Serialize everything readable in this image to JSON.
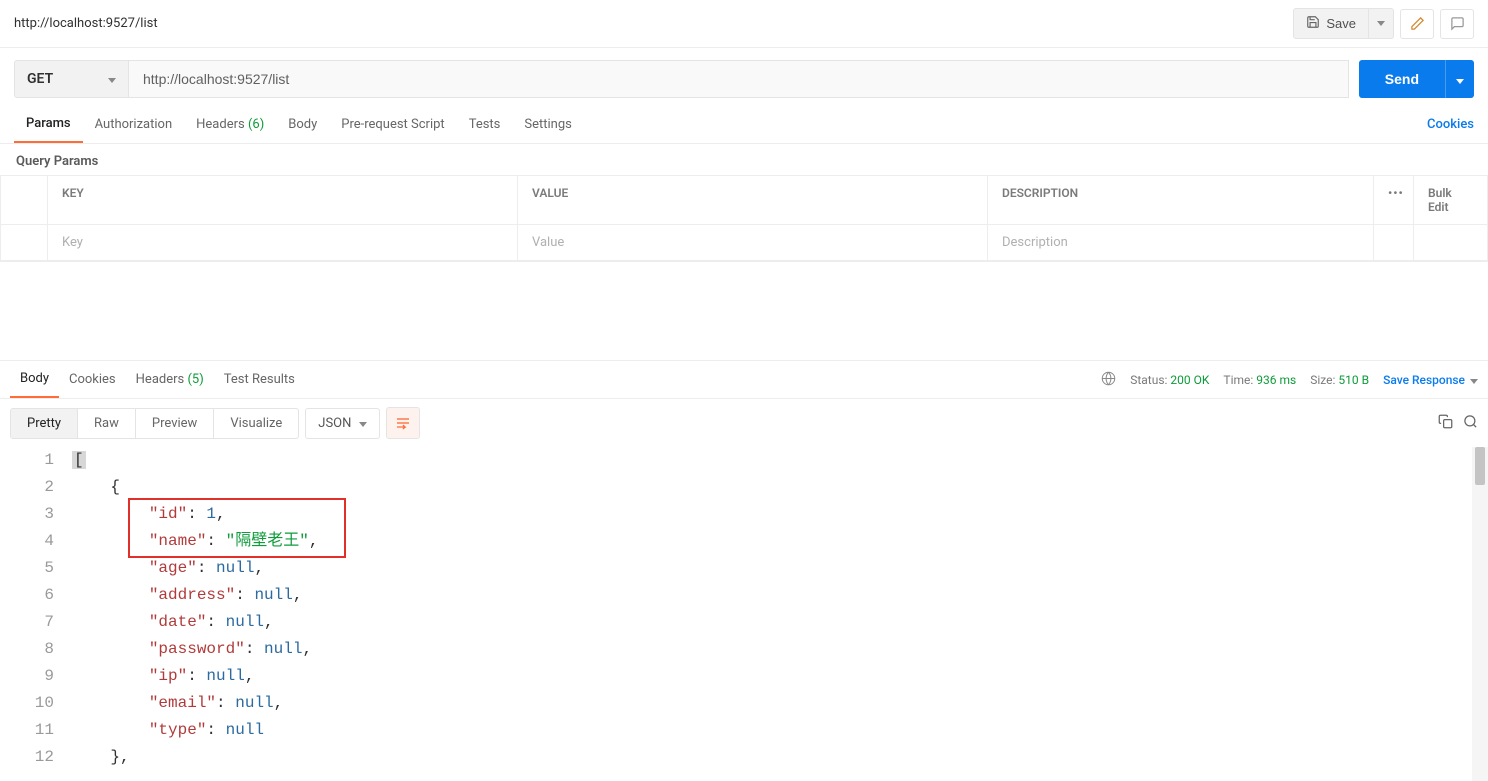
{
  "request": {
    "title": "http://localhost:9527/list",
    "method": "GET",
    "url": "http://localhost:9527/list",
    "saveLabel": "Save",
    "sendLabel": "Send"
  },
  "reqTabs": {
    "params": "Params",
    "authorization": "Authorization",
    "headers": "Headers",
    "headersCount": "(6)",
    "body": "Body",
    "prerequest": "Pre-request Script",
    "tests": "Tests",
    "settings": "Settings",
    "cookies": "Cookies"
  },
  "queryParams": {
    "sectionLabel": "Query Params",
    "colKey": "KEY",
    "colValue": "VALUE",
    "colDesc": "DESCRIPTION",
    "bulkEdit": "Bulk Edit",
    "more": "•••",
    "phKey": "Key",
    "phValue": "Value",
    "phDesc": "Description"
  },
  "respTabs": {
    "body": "Body",
    "cookies": "Cookies",
    "headers": "Headers",
    "headersCount": "(5)",
    "testResults": "Test Results"
  },
  "respMeta": {
    "statusLabel": "Status:",
    "statusValue": "200 OK",
    "timeLabel": "Time:",
    "timeValue": "936 ms",
    "sizeLabel": "Size:",
    "sizeValue": "510 B",
    "saveResponse": "Save Response"
  },
  "viewSeg": {
    "pretty": "Pretty",
    "raw": "Raw",
    "preview": "Preview",
    "visualize": "Visualize",
    "format": "JSON"
  },
  "responseBody": [
    {
      "id": 1,
      "name": "隔壁老王",
      "age": null,
      "address": null,
      "date": null,
      "password": null,
      "ip": null,
      "email": null,
      "type": null
    }
  ]
}
